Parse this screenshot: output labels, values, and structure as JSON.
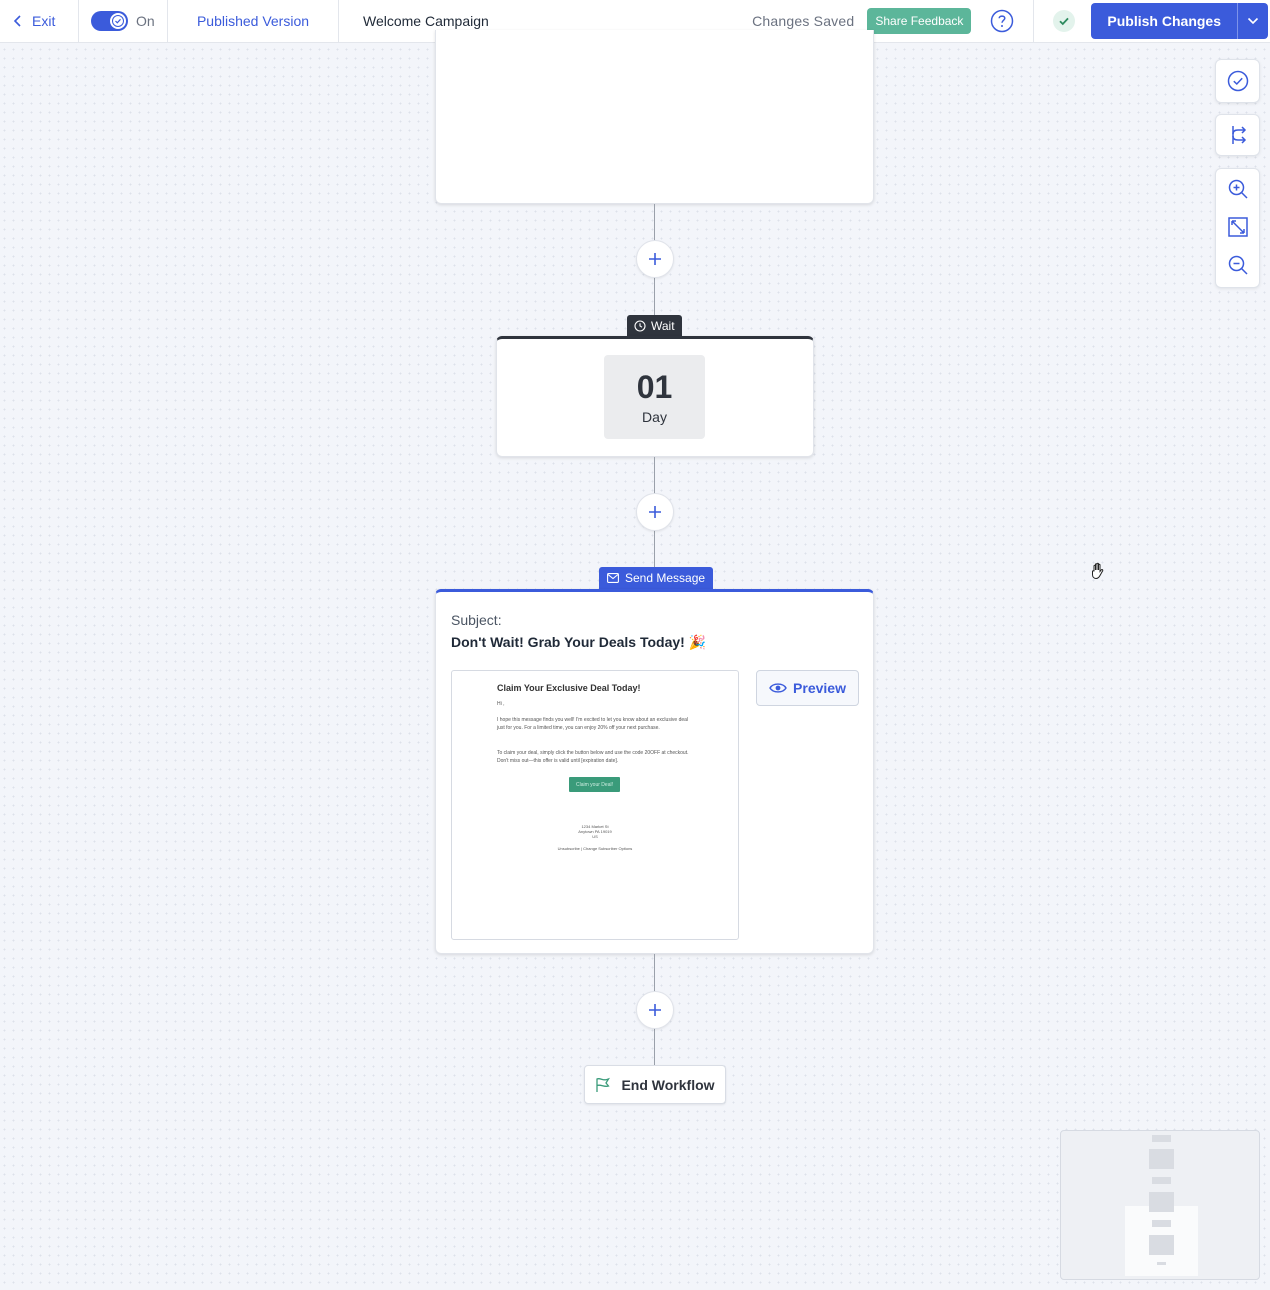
{
  "topbar": {
    "exit_label": "Exit",
    "toggle_label": "On",
    "published_version_label": "Published Version",
    "workflow_name": "Welcome Campaign",
    "status_text": "Changes Saved",
    "feedback_label": "Share Feedback",
    "publish_label": "Publish Changes",
    "accent_color": "#3b5bdb"
  },
  "wait_step": {
    "tag_label": "Wait",
    "amount": "01",
    "unit": "Day"
  },
  "message_step": {
    "tag_label": "Send Message",
    "subject_label": "Subject:",
    "subject_text": "Don't Wait! Grab Your Deals Today! 🎉",
    "preview_label": "Preview",
    "email": {
      "title": "Claim Your Exclusive Deal Today!",
      "greeting": "Hi ,",
      "paragraph_1": "I hope this message finds you well! I'm excited to let you know about an exclusive deal just for you. For a limited time, you can enjoy 20% off your next purchase.",
      "paragraph_2": "To claim your deal, simply click the button below and use the code 20OFF at checkout. Don't miss out—this offer is valid until [expiration date].",
      "button_label": "Claim your Deal!",
      "address_line_1": "1234 Market St",
      "address_line_2": "Anytown PA 19019",
      "address_line_3": "US",
      "footer_links": "Unsubscribe  |  Change Subscriber Options"
    }
  },
  "end_step": {
    "label": "End Workflow"
  },
  "icons": {
    "exit": "chevron-left-icon",
    "help": "question-circle-icon",
    "status": "check-circle-icon",
    "tools": [
      "check-circle-icon",
      "branch-icon",
      "zoom-in-icon",
      "fit-screen-icon",
      "zoom-out-icon"
    ]
  }
}
